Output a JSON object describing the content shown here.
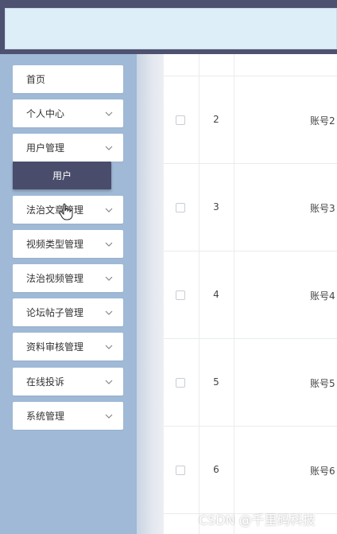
{
  "sidebar": {
    "items": [
      {
        "label": "首页",
        "has_chevron": false
      },
      {
        "label": "个人中心",
        "has_chevron": true
      },
      {
        "label": "用户管理",
        "has_chevron": true
      },
      {
        "label": "法治文章管理",
        "has_chevron": true
      },
      {
        "label": "视频类型管理",
        "has_chevron": true
      },
      {
        "label": "法治视频管理",
        "has_chevron": true
      },
      {
        "label": "论坛帖子管理",
        "has_chevron": true
      },
      {
        "label": "资料审核管理",
        "has_chevron": true
      },
      {
        "label": "在线投诉",
        "has_chevron": true
      },
      {
        "label": "系统管理",
        "has_chevron": true
      }
    ],
    "submenu_label": "用户"
  },
  "table": {
    "rows": [
      {
        "index": "2",
        "account": "账号2"
      },
      {
        "index": "3",
        "account": "账号3"
      },
      {
        "index": "4",
        "account": "账号4"
      },
      {
        "index": "5",
        "account": "账号5"
      },
      {
        "index": "6",
        "account": "账号6"
      }
    ]
  },
  "watermark": "CSDN @千里码科技",
  "colors": {
    "topbar": "#4f5170",
    "header_strip": "#ddeef8",
    "sidebar": "#9fb9d6",
    "submenu": "#4a4c6b"
  }
}
